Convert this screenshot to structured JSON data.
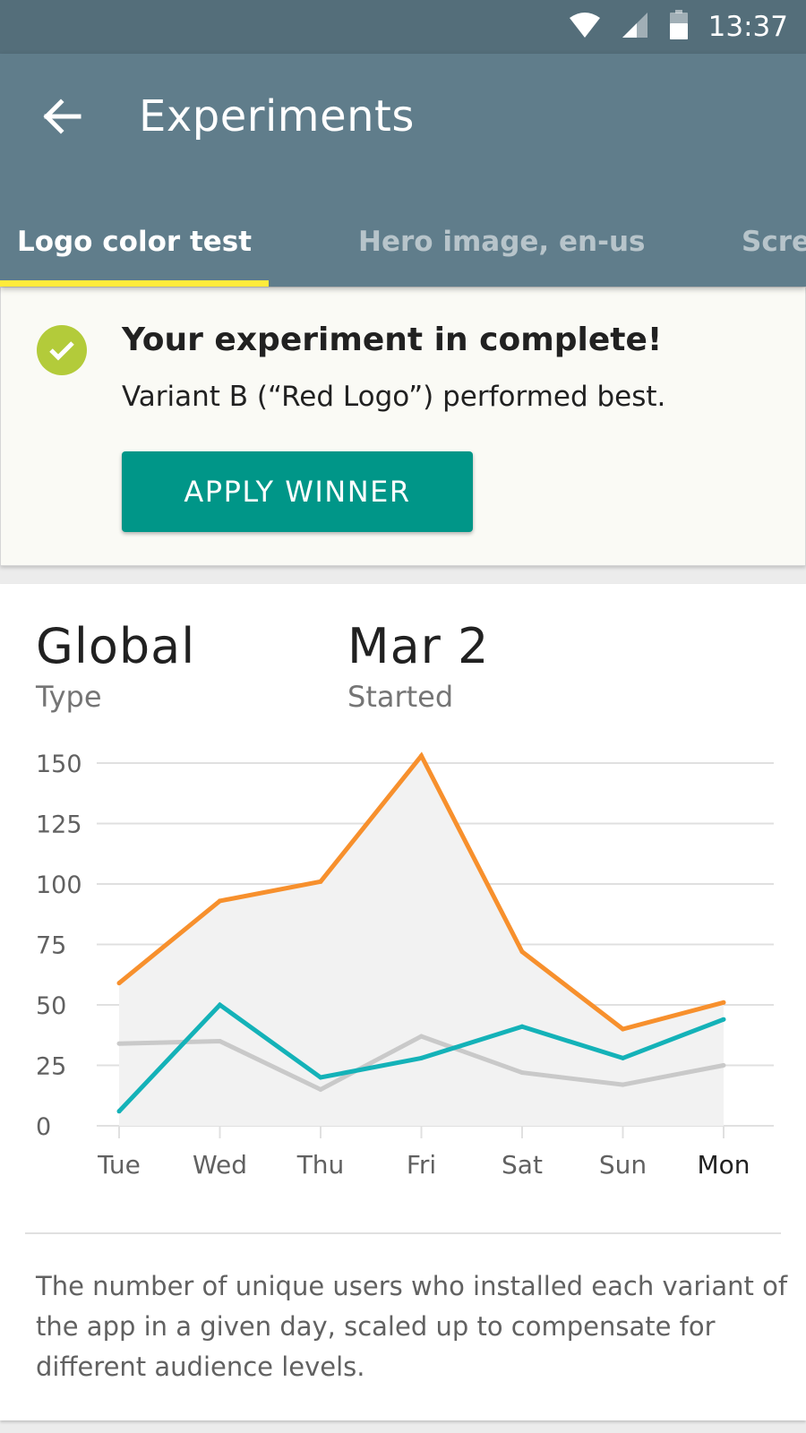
{
  "status_bar": {
    "time": "13:37",
    "icons": [
      "wifi-icon",
      "cell-signal-icon",
      "battery-icon"
    ]
  },
  "app_bar": {
    "back_icon": "arrow-back-icon",
    "title": "Experiments"
  },
  "tabs": [
    {
      "label": "Logo color test",
      "active": true
    },
    {
      "label": "Hero image, en-us",
      "active": false
    },
    {
      "label": "Scre",
      "active": false
    }
  ],
  "notice": {
    "icon": "check-circle-icon",
    "title": "Your experiment in complete!",
    "body": "Variant B (“Red Logo”) performed best.",
    "button_label": "APPLY WINNER"
  },
  "stats": {
    "type_value": "Global",
    "type_label": "Type",
    "started_value": "Mar 2",
    "started_label": "Started"
  },
  "chart_data": {
    "type": "line",
    "title": "",
    "xlabel": "",
    "ylabel": "",
    "categories": [
      "Tue",
      "Wed",
      "Thu",
      "Fri",
      "Sat",
      "Sun",
      "Mon"
    ],
    "highlighted_category": "Mon",
    "y_ticks": [
      "150",
      "125",
      "100",
      "75",
      "50",
      "25",
      "0"
    ],
    "ylim": [
      0,
      150
    ],
    "grid": true,
    "series": [
      {
        "values": [
          59,
          93,
          101,
          153,
          72,
          40,
          51
        ],
        "color": "#f7902d",
        "filled": true
      },
      {
        "values": [
          6,
          50,
          20,
          28,
          41,
          28,
          44
        ],
        "color": "#14b2b8",
        "filled": false
      },
      {
        "values": [
          34,
          35,
          15,
          37,
          22,
          17,
          25
        ],
        "color": "#c9c9c9",
        "filled": false
      }
    ],
    "colors": {
      "fill": "#f2f2f2",
      "grid": "#e0e0e0",
      "tick": "#616161",
      "highlight": "#212121"
    }
  },
  "caption": "The number of unique users who installed each variant of the app in a given day, scaled up to compensate for different audience levels."
}
